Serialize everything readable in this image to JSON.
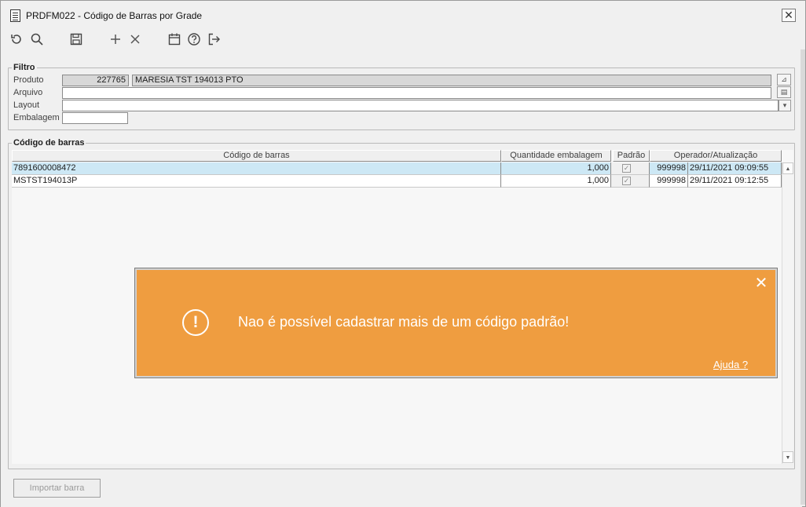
{
  "window": {
    "title": "PRDFM022 - Código de Barras por Grade",
    "close_glyph": "✕"
  },
  "toolbar": {
    "icons": [
      "undo-icon",
      "search-icon",
      "save-icon",
      "add-icon",
      "delete-icon",
      "calendar-icon",
      "help-icon",
      "exit-icon"
    ]
  },
  "filtro": {
    "legend": "Filtro",
    "produto_label": "Produto",
    "produto_code": "227765",
    "produto_desc": "MARESIA TST 194013 PTO",
    "arquivo_label": "Arquivo",
    "arquivo_value": "",
    "layout_label": "Layout",
    "layout_value": "",
    "embalagem_label": "Embalagem",
    "embalagem_value": ""
  },
  "barcodes": {
    "legend": "Código de barras",
    "columns": [
      "Código de barras",
      "Quantidade embalagem",
      "Padrão",
      "Operador/Atualização"
    ],
    "rows": [
      {
        "codigo": "7891600008472",
        "quantidade": "1,000",
        "padrao": true,
        "operador": "999998",
        "atualizacao": "29/11/2021 09:09:55"
      },
      {
        "codigo": "MSTST194013P",
        "quantidade": "1,000",
        "padrao": true,
        "operador": "999998",
        "atualizacao": "29/11/2021 09:12:55"
      }
    ]
  },
  "footer": {
    "importar_label": "Importar barra"
  },
  "toast": {
    "message": "Nao é possível cadastrar mais de um código padrão!",
    "help_link": "Ajuda ?",
    "close_glyph": "✕",
    "icon_glyph": "!",
    "background": "#ef9d40"
  }
}
